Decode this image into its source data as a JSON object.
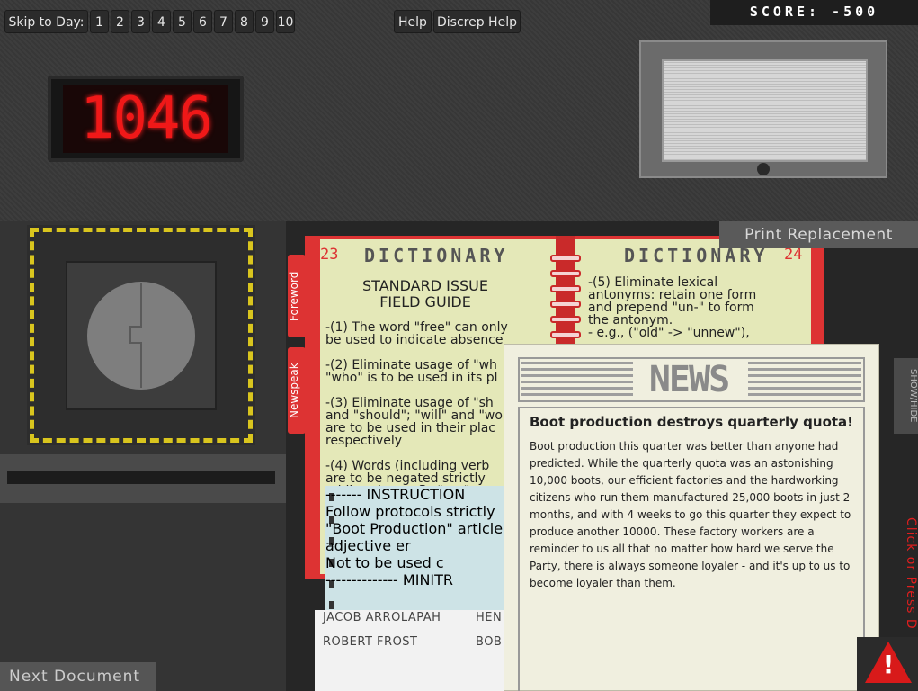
{
  "toolbar": {
    "skip_label": "Skip to Day:",
    "days": [
      "1",
      "2",
      "3",
      "4",
      "5",
      "6",
      "7",
      "8",
      "9",
      "10"
    ],
    "help": "Help",
    "discrep_help": "Discrep Help"
  },
  "score": "SCORE: -500",
  "clock": "1046",
  "print_replacement": "Print Replacement",
  "next_document": "Next Document",
  "dictionary": {
    "left_page_number": "23",
    "right_page_number": "24",
    "title": "DICTIONARY",
    "heading": "STANDARD ISSUE\nFIELD GUIDE",
    "tab_foreword": "Foreword",
    "tab_newspeak": "Newspeak",
    "left_rules": "-(1) The word \"free\" can only\nbe used to indicate absence\n\n-(2) Eliminate usage of \"wh\n\"who\" is to be used in its pl\n\n-(3) Eliminate usage of \"sh\nand \"should\"; \"will\" and \"wou\nare to be used in their plac\nrespectively\n\n-(4) Words (including verb\nare to be negated strictly\nadding the prefix \"un-\" to t",
    "right_rules": "-(5) Eliminate lexical\nantonyms: retain one form\nand prepend \"un-\" to form\nthe antonym.\n- e.g., (\"old\" -> \"unnew\"),"
  },
  "instruction": {
    "line1": "------- INSTRUCTION",
    "line2": "Follow protocols strictly",
    "line3": "\"Boot Production\" article",
    "line4": "adjective er",
    "line5": "Not to be used c",
    "line6": "-------------- MINITR"
  },
  "names": [
    {
      "first": "JACOB ARROLAPAH",
      "second": "HEN"
    },
    {
      "first": "ROBERT FROST",
      "second": "BOB"
    }
  ],
  "news": {
    "logo": "NEWS",
    "headline": "Boot production destroys quarterly quota!",
    "article": "Boot production this quarter was better than anyone had predicted. While the quarterly quota was an astonishing 10,000 boots, our efficient factories and the hardworking citizens who run them manufactured 25,000 boots in just 2 months, and with 4 weeks to go this quarter they expect to produce another 10000. These factory workers are a reminder to us all that no matter how hard we serve the Party, there is always someone loyaler - and it's up to us to become loyaler than them."
  },
  "show_hide": "SHOW/HIDE",
  "click_hint": "Click or Press D"
}
